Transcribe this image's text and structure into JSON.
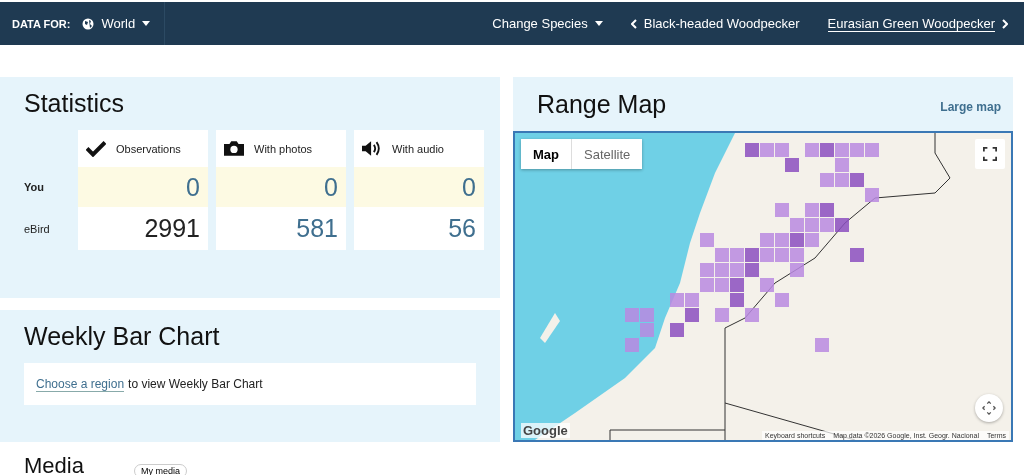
{
  "header": {
    "data_for_label": "DATA FOR:",
    "region": "World",
    "change_species": "Change Species",
    "previous_species": "Black-headed Woodpecker",
    "next_species": "Eurasian Green Woodpecker"
  },
  "statistics": {
    "title": "Statistics",
    "columns": [
      {
        "label": "Observations",
        "kind": "check"
      },
      {
        "label": "With photos",
        "kind": "camera"
      },
      {
        "label": "With audio",
        "kind": "audio"
      }
    ],
    "rows": [
      {
        "label": "You",
        "highlighted": true,
        "cells": [
          {
            "value": "0",
            "link": true
          },
          {
            "value": "0",
            "link": true
          },
          {
            "value": "0",
            "link": true
          }
        ]
      },
      {
        "label": "eBird",
        "highlighted": false,
        "cells": [
          {
            "value": "2991",
            "link": false
          },
          {
            "value": "581",
            "link": true
          },
          {
            "value": "56",
            "link": true
          }
        ]
      }
    ]
  },
  "range_map": {
    "title": "Range Map",
    "large_map_link": "Large map",
    "map_types": [
      {
        "label": "Map",
        "selected": true
      },
      {
        "label": "Satellite",
        "selected": false
      }
    ],
    "logo": "Google",
    "keyboard_shortcuts": "Keyboard shortcuts",
    "map_data": "Map data ©2026 Google, Inst. Geogr. Nacional",
    "terms": "Terms"
  },
  "weekly_bar_chart": {
    "title": "Weekly Bar Chart",
    "link": "Choose a region",
    "message": "to view Weekly Bar Chart"
  },
  "media": {
    "title": "Media",
    "button": "My media"
  }
}
